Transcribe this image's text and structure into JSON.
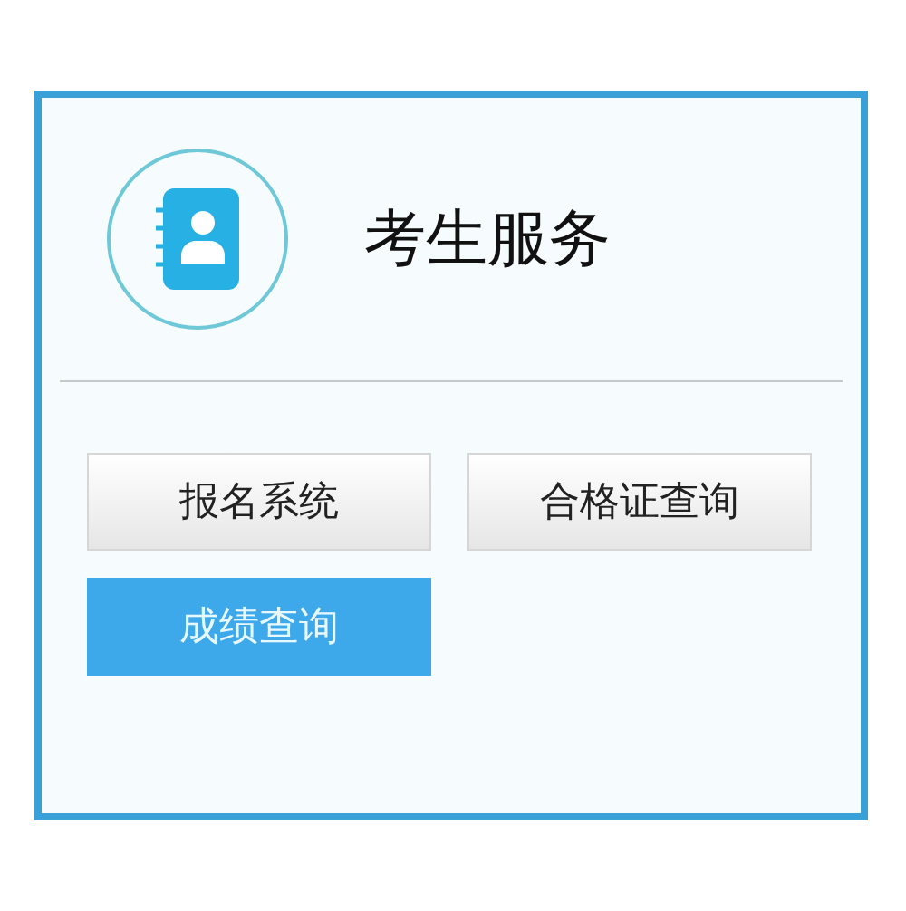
{
  "header": {
    "title": "考生服务"
  },
  "buttons": [
    {
      "label": "报名系统",
      "selected": false
    },
    {
      "label": "合格证查询",
      "selected": false
    },
    {
      "label": "成绩查询",
      "selected": true
    }
  ]
}
